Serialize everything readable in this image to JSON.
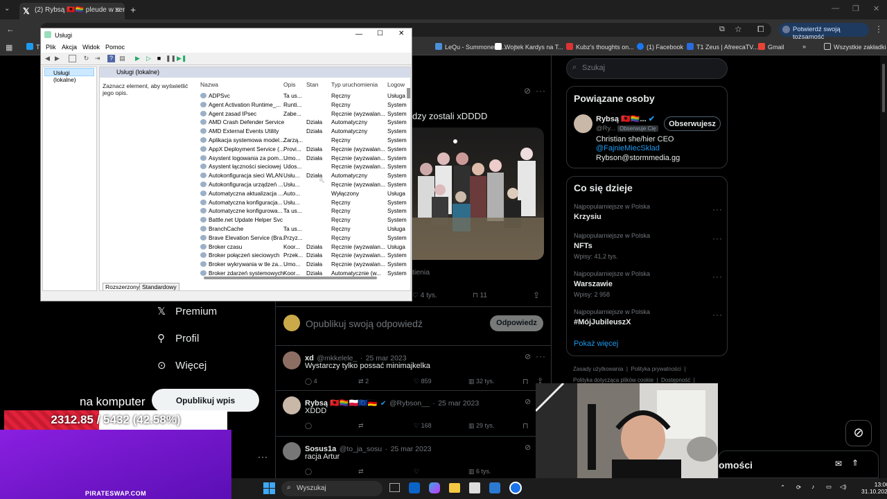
{
  "browser": {
    "tab_title": "(2) Rybsą 🇦🇱🏳️‍🌈 pleude w serwisie X",
    "verify_label": "Potwierdź swoją tożsamość",
    "bookmarks": [
      "T",
      "LeQu - Summoner S...",
      "Wojtek Kardys na T...",
      "Kubz's thoughts on...",
      "(1) Facebook",
      "T1 Zeus | AfreecaTV...",
      "Gmail"
    ],
    "all_bookmarks": "Wszystkie zakładki"
  },
  "twitter": {
    "search_placeholder": "Szukaj",
    "tweet_fragment": "dzy zostali xDDDD",
    "views_fragment": "tienia",
    "stats_main": {
      "likes": "4 tys.",
      "bookmarks": "11"
    },
    "nav": {
      "premium": "Premium",
      "profile": "Profil",
      "more": "Więcej",
      "post_button": "Opublikuj wpis"
    },
    "reply_placeholder": "Opublikuj swoją odpowiedź",
    "reply_button": "Odpowiedz",
    "related": {
      "title": "Powiązane osoby",
      "name": "Rybsą 🇦🇱🏳️‍🌈...",
      "handle": "@Ry...",
      "follows_you": "Obserwuje Cię",
      "follow_button": "Obserwujesz",
      "bio_line1": "Christian she/hier CEO",
      "bio_line2": "@FajnieMiecSklad",
      "bio_line3": "Rybson@stormmedia.gg"
    },
    "trends": {
      "title": "Co się dzieje",
      "items": [
        {
          "context": "Najpopularniejsze w Polska",
          "name": "Krzysiu",
          "posts": ""
        },
        {
          "context": "Najpopularniejsze w Polska",
          "name": "NFTs",
          "posts": "Wpisy: 41,2 tys."
        },
        {
          "context": "Najpopularniejsze w Polska",
          "name": "Warszawie",
          "posts": "Wpisy: 2 958"
        },
        {
          "context": "Najpopularniejsze w Polska",
          "name": "#MójJubileuszX",
          "posts": ""
        }
      ],
      "show_more": "Pokaż więcej"
    },
    "footer": {
      "line1a": "Zasady użytkowania",
      "line1b": "Polityka prywatności",
      "line2a": "Polityka dotycząca plików cookie",
      "line2b": "Dostępność"
    },
    "replies": [
      {
        "name": "xd",
        "handle": "@mkkelele_",
        "date": "25 mar 2023",
        "text": "Wystarczy tylko possać minimajkelka",
        "replies": "4",
        "retweets": "2",
        "likes": "859",
        "views": "32 tys."
      },
      {
        "name": "Rybsą 🇦🇱🏳️‍🌈🇵🇱🇪🇺🇩🇪",
        "handle": "@Rybson__",
        "date": "25 mar 2023",
        "text": "XDDD",
        "replies": "",
        "retweets": "",
        "likes": "168",
        "views": "29 tys."
      },
      {
        "name": "Sosus1a",
        "handle": "@to_ja_sosu",
        "date": "25 mar 2023",
        "text": "racja Artur",
        "replies": "",
        "retweets": "",
        "likes": "",
        "views": "6 tys."
      }
    ],
    "messages_label": "omości",
    "na_komputer": "na komputer"
  },
  "services": {
    "title": "Usługi",
    "menu": [
      "Plik",
      "Akcja",
      "Widok",
      "Pomoc"
    ],
    "tree_item": "Usługi (lokalne)",
    "panel_header": "Usługi (lokalne)",
    "description": "Zaznacz element, aby wyświetlić jego opis.",
    "columns": [
      "Nazwa",
      "Opis",
      "Stan",
      "Typ uruchomienia",
      "Logow"
    ],
    "rows": [
      [
        "ADPSvc",
        "Ta us...",
        "",
        "Ręczny",
        "Usługa"
      ],
      [
        "Agent Activation Runtime_...",
        "Runti...",
        "",
        "Ręczny",
        "System"
      ],
      [
        "Agent zasad IPsec",
        "Zabe...",
        "",
        "Ręcznie (wyzwalan...",
        "System"
      ],
      [
        "AMD Crash Defender Service",
        "",
        "Działa",
        "Automatyczny",
        "System"
      ],
      [
        "AMD External Events Utility",
        "",
        "Działa",
        "Automatyczny",
        "System"
      ],
      [
        "Aplikacja systemowa model...",
        "Zarzą...",
        "",
        "Ręczny",
        "System"
      ],
      [
        "AppX Deployment Service (...",
        "Provi...",
        "Działa",
        "Ręcznie (wyzwalan...",
        "System"
      ],
      [
        "Asystent logowania za pom...",
        "Umo...",
        "Działa",
        "Ręcznie (wyzwalan...",
        "System"
      ],
      [
        "Asystent łączności sieciowej",
        "Udos...",
        "",
        "Ręcznie (wyzwalan...",
        "System"
      ],
      [
        "Autokonfiguracja sieci WLAN",
        "Usłu...",
        "Działa",
        "Automatyczny",
        "System"
      ],
      [
        "Autokonfiguracja urządzeń ...",
        "Usłu...",
        "",
        "Ręcznie (wyzwalan...",
        "System"
      ],
      [
        "Automatyczna aktualizacja ...",
        "Auto...",
        "",
        "Wyłączony",
        "Usługa"
      ],
      [
        "Automatyczna konfiguracja...",
        "Usłu...",
        "",
        "Ręczny",
        "System"
      ],
      [
        "Automatyczne konfigurowa...",
        "Ta us...",
        "",
        "Ręczny",
        "System"
      ],
      [
        "Battle.net Update Helper Svc",
        "",
        "",
        "Ręczny",
        "System"
      ],
      [
        "BranchCache",
        "Ta us...",
        "",
        "Ręczny",
        "Usługa"
      ],
      [
        "Brave Elevation Service (Bra...",
        "Przyz...",
        "",
        "Ręczny",
        "System"
      ],
      [
        "Broker czasu",
        "Koor...",
        "Działa",
        "Ręcznie (wyzwalan...",
        "Usługa"
      ],
      [
        "Broker połączeń sieciowych",
        "Przek...",
        "Działa",
        "Ręcznie (wyzwalan...",
        "System"
      ],
      [
        "Broker wykrywania w tle za...",
        "Umo...",
        "Działa",
        "Ręcznie (wyzwalan...",
        "System"
      ],
      [
        "Broker zdarzeń systemowych",
        "Koor...",
        "Działa",
        "Automatycznie (w...",
        "System"
      ]
    ],
    "tabs": [
      "Rozszerzony",
      "Standardowy"
    ]
  },
  "overlay": {
    "donation_text": "2312.85 / 5432 (42.58%)",
    "donation_progress": 0.4258,
    "promo_label": "PIRATESWAP.COM"
  },
  "taskbar": {
    "search_label": "Wyszukaj",
    "time": "13:06",
    "date": "31.10.2025"
  },
  "colors": {
    "accent": "#1d9bf0",
    "donation": "#e0233a",
    "promo": "#7b18d6"
  }
}
